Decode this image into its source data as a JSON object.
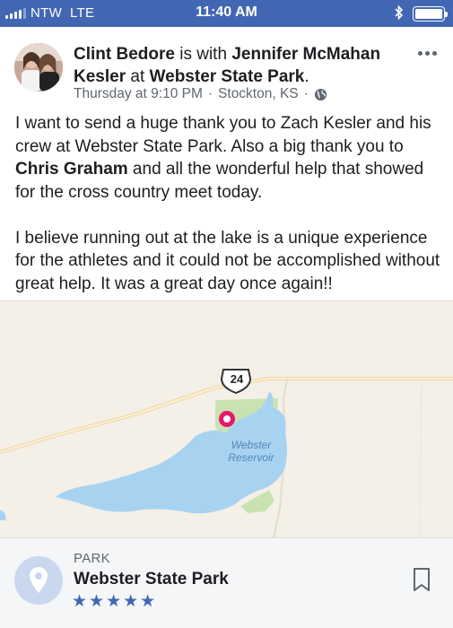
{
  "status_bar": {
    "carrier": "NTW",
    "network": "LTE",
    "time": "11:40 AM"
  },
  "post": {
    "author": "Clint Bedore",
    "with_text": "is with",
    "tagged_person": "Jennifer McMahan Kesler",
    "at_text": "at",
    "place": "Webster State Park",
    "period": ".",
    "timestamp": "Thursday at 9:10 PM",
    "separator": "·",
    "location": "Stockton, KS",
    "separator2": "·",
    "para1_a": "I want to send a huge thank you to Zach Kesler and his crew at Webster State Park. Also a big thank you to ",
    "para1_mention": "Chris Graham",
    "para1_b": " and all the wonderful help that showed for the cross country meet today.",
    "para2": "I believe running out at the lake is a unique experience for the athletes and it could not be accomplished without great help.  It was a great day once again!!"
  },
  "map": {
    "highway_number": "24",
    "lake_label_line1": "Webster",
    "lake_label_line2": "Reservoir"
  },
  "place_card": {
    "type": "PARK",
    "name": "Webster State Park",
    "rating_stars": "★★★★★",
    "rating": 5
  },
  "colors": {
    "status_bar": "#4267b2",
    "star": "#4267b2",
    "pin": "#e8176f",
    "water": "#a8d3f0",
    "park": "#c9e3b0"
  },
  "icons": {
    "more": "more-horizontal-icon",
    "globe": "globe-icon",
    "bookmark": "bookmark-icon",
    "place": "location-pin-icon",
    "bluetooth": "bluetooth-icon",
    "battery": "battery-icon"
  }
}
